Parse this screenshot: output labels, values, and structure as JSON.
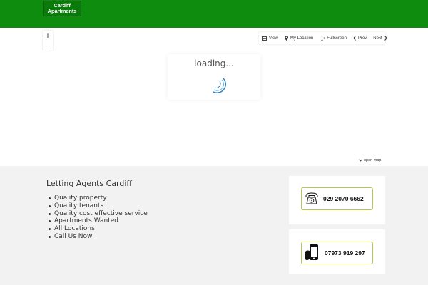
{
  "header": {
    "logo": {
      "line1": "Cardiff",
      "line2": "Apartments"
    },
    "brand_color": "#0d8c0d"
  },
  "map": {
    "zoom_in_label": "+",
    "zoom_out_label": "−",
    "toolbar": {
      "view_label": "View",
      "my_location_label": "My Location",
      "fullscreen_label": "Fullscreen",
      "prev_label": "Prev",
      "next_label": "Next"
    },
    "loading_text": "loading...",
    "open_map_label": "open map",
    "spinner_color": "#2a7fc1"
  },
  "footer": {
    "title": "Letting Agents Cardiff",
    "items": [
      "Quality property",
      "Quality tenants",
      "Quality cost effective service",
      "Apartments Wanted",
      "All Locations",
      "Call Us Now"
    ],
    "landline": "029 2070 6662",
    "mobile": "07973 919 297",
    "accent_color": "#b8c94a"
  },
  "icons": [
    "image-icon",
    "map-pin-icon",
    "move-icon",
    "chevron-left-icon",
    "chevron-right-icon",
    "chevron-down-icon",
    "telephone-icon",
    "mobile-phone-icon"
  ]
}
